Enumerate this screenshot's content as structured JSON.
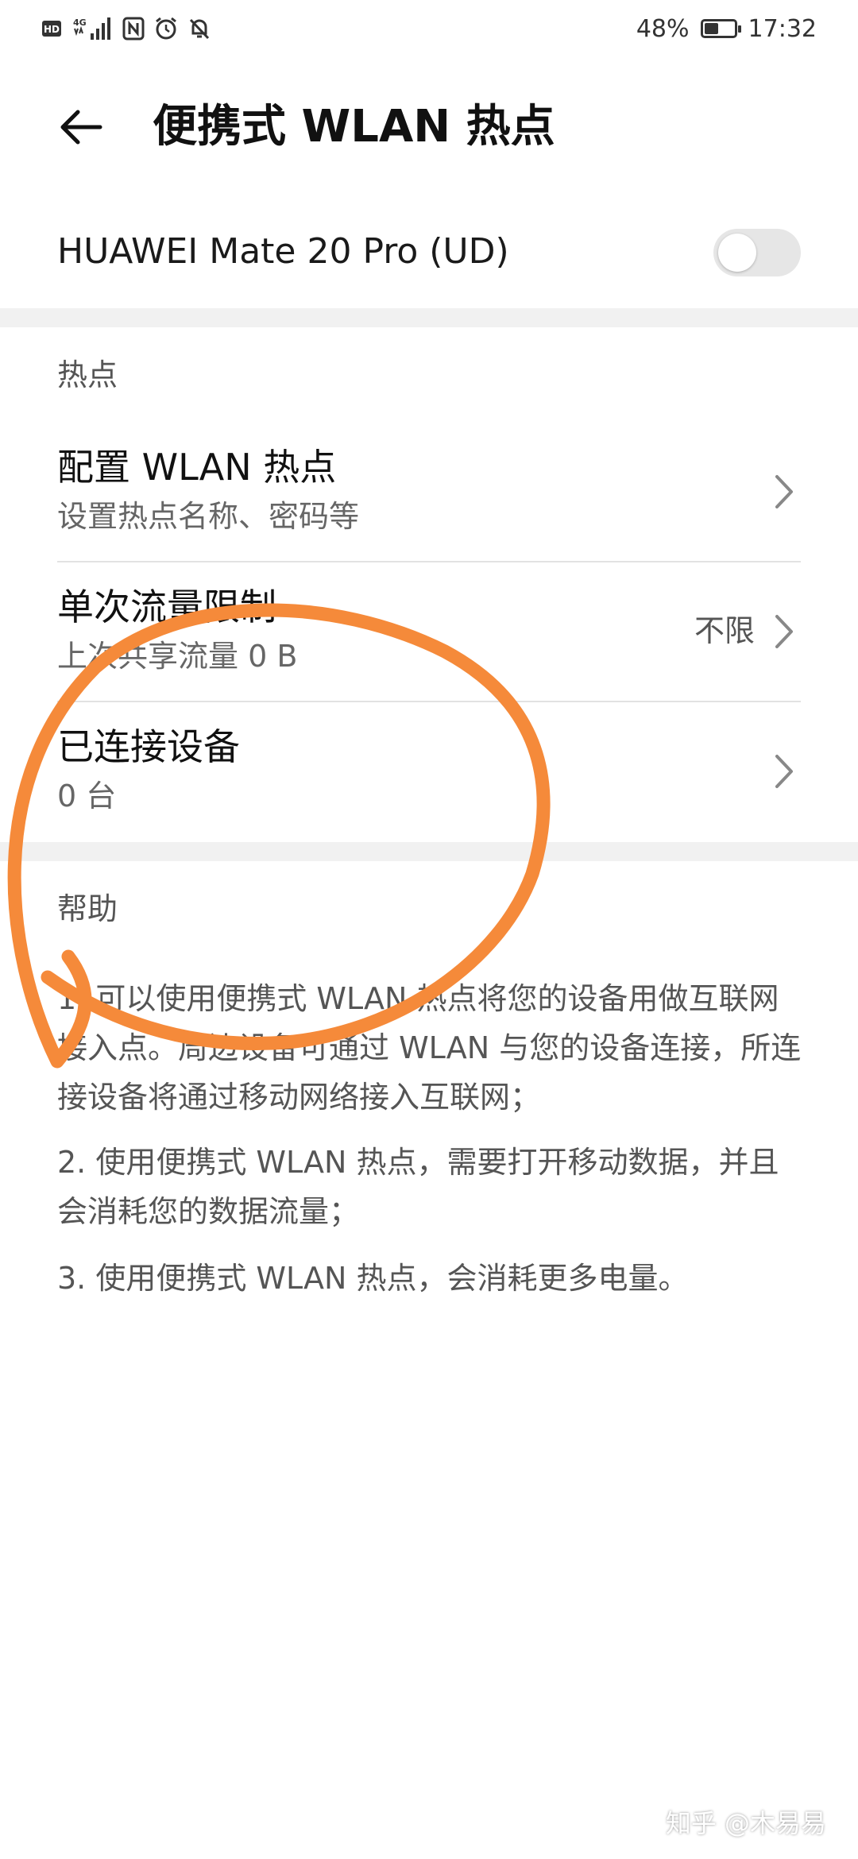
{
  "status_bar": {
    "left_icons": [
      "hd-icon",
      "signal-4g-icon",
      "nfc-icon",
      "alarm-icon",
      "mute-icon"
    ],
    "hd_label": "HD",
    "network_label": "4G",
    "battery_percent": "48%",
    "battery_level": 0.48,
    "time": "17:32"
  },
  "toolbar": {
    "title": "便携式 WLAN 热点"
  },
  "hotspot": {
    "name": "HUAWEI Mate 20 Pro (UD)",
    "enabled": false
  },
  "sections": {
    "hotspot_header": "热点",
    "help_header": "帮助"
  },
  "items": [
    {
      "title": "配置 WLAN 热点",
      "subtitle": "设置热点名称、密码等",
      "value": ""
    },
    {
      "title": "单次流量限制",
      "subtitle": "上次共享流量 0 B",
      "value": "不限"
    },
    {
      "title": "已连接设备",
      "subtitle": "0 台",
      "value": ""
    }
  ],
  "help": [
    "1. 可以使用便携式 WLAN 热点将您的设备用做互联网接入点。周边设备可通过 WLAN 与您的设备连接，所连接设备将通过移动网络接入互联网；",
    "2. 使用便携式 WLAN 热点，需要打开移动数据，并且会消耗您的数据流量；",
    "3. 使用便携式 WLAN 热点，会消耗更多电量。"
  ],
  "watermark": "知乎 @木易易",
  "colors": {
    "annotation": "#F58A3A",
    "switch_off": "#e6e6e6"
  }
}
